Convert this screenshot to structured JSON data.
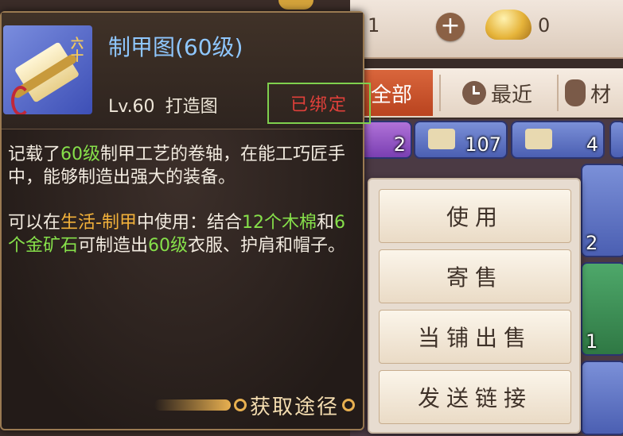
{
  "top_bar": {
    "count_left": "1",
    "plus_label": "+",
    "gold_count": "0"
  },
  "filter_tabs": [
    {
      "label": "全部",
      "icon": "none"
    },
    {
      "label": "最近",
      "icon": "clock-icon"
    },
    {
      "label": "材",
      "icon": "jar-icon"
    }
  ],
  "inventory_slots": [
    {
      "count": "2"
    },
    {
      "count": "107"
    },
    {
      "count": "4"
    },
    {
      "count": "2"
    },
    {
      "count": "1"
    }
  ],
  "item": {
    "icon_tag": "六十",
    "name": "制甲图(60级)",
    "level": "Lv.60",
    "type": "打造图",
    "bound_status": "已绑定",
    "desc1": [
      {
        "text": "记载了",
        "hl": ""
      },
      {
        "text": "60级",
        "hl": "green"
      },
      {
        "text": "制甲工艺的卷轴，在能工巧匠手中，能够制造出强大的装备。",
        "hl": ""
      }
    ],
    "desc2": [
      {
        "text": "可以在",
        "hl": ""
      },
      {
        "text": "生活-制甲",
        "hl": "gold"
      },
      {
        "text": "中使用：结合",
        "hl": ""
      },
      {
        "text": "12个木棉",
        "hl": "green"
      },
      {
        "text": "和",
        "hl": ""
      },
      {
        "text": "6个金矿石",
        "hl": "green"
      },
      {
        "text": "可制造出",
        "hl": ""
      },
      {
        "text": "60级",
        "hl": "green"
      },
      {
        "text": "衣服、护肩和帽子。",
        "hl": ""
      }
    ],
    "source_label": "获取途径"
  },
  "colors": {
    "highlight_green": "#86e04a",
    "highlight_gold": "#f2b13a",
    "bound_red": "#e0403a",
    "name_blue": "#8fc7ff"
  },
  "menu": {
    "use": "使用",
    "consign": "寄售",
    "pawn_sell": "当铺出售",
    "send_link": "发送链接"
  }
}
